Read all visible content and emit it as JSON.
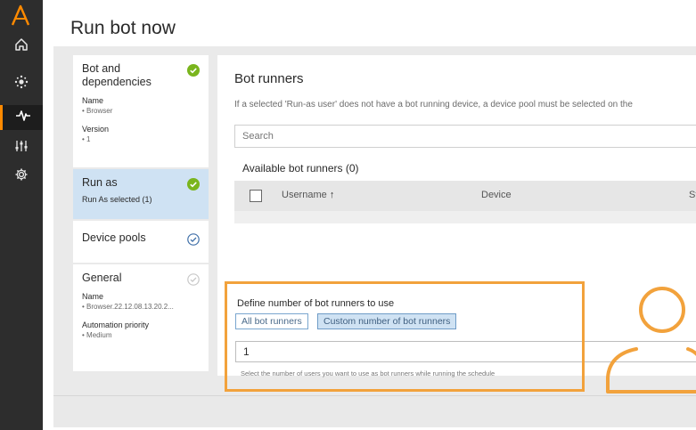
{
  "page": {
    "title": "Run bot now"
  },
  "rail": {
    "items": [
      {
        "icon": "home-icon"
      },
      {
        "icon": "bots-icon"
      },
      {
        "icon": "activity-icon",
        "active": true
      },
      {
        "icon": "manage-icon"
      },
      {
        "icon": "administration-icon"
      }
    ]
  },
  "steps": {
    "bot": {
      "title": "Bot and dependencies",
      "name_label": "Name",
      "name_value": "• Browser",
      "version_label": "Version",
      "version_value": "• 1"
    },
    "runas": {
      "title": "Run as",
      "subtitle": "Run As selected (1)"
    },
    "pools": {
      "title": "Device pools"
    },
    "general": {
      "title": "General",
      "name_label": "Name",
      "name_value": "• Browser.22.12.08.13.20.2...",
      "priority_label": "Automation priority",
      "priority_value": "• Medium"
    }
  },
  "bot_runners": {
    "title": "Bot runners",
    "note": "If a selected 'Run-as user' does not have a bot running device, a device pool must be selected on the",
    "search_placeholder": "Search",
    "available_label": "Available bot runners (0)",
    "columns": [
      "Username",
      "Device",
      "St"
    ],
    "sort_icon": "arrow-up-icon"
  },
  "define": {
    "label": "Define number of bot runners to use",
    "options": [
      "All bot runners",
      "Custom number of bot runners"
    ],
    "selected": "Custom number of bot runners",
    "value": "1",
    "hint": "Select the number of users you want to use as bot runners while running the schedule"
  },
  "colors": {
    "accent": "#ff8a00",
    "highlight": "#f2a23c",
    "success": "#7ab51d",
    "selected_bg": "#cfe2f3"
  }
}
